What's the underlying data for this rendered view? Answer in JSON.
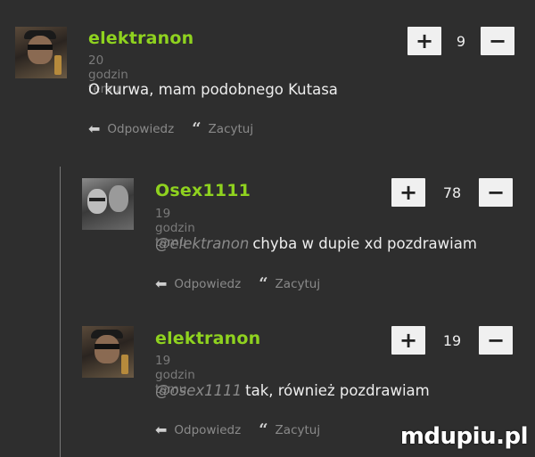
{
  "comments": [
    {
      "username": "elektranon",
      "timestamp": "20 godzin temu",
      "mention": "",
      "text": "O kurwa, mam podobnego Kutasa",
      "votes": "9",
      "reply_label": "Odpowiedz",
      "quote_label": "Zacytuj"
    },
    {
      "username": "Osex1111",
      "timestamp": "19 godzin temu",
      "mention": "@elektranon",
      "text": "chyba w dupie xd pozdrawiam",
      "votes": "78",
      "reply_label": "Odpowiedz",
      "quote_label": "Zacytuj"
    },
    {
      "username": "elektranon",
      "timestamp": "19 godzin temu",
      "mention": "@osex1111",
      "text": "tak, również pozdrawiam",
      "votes": "19",
      "reply_label": "Odpowiedz",
      "quote_label": "Zacytuj"
    }
  ],
  "vote_buttons": {
    "plus": "+",
    "minus": "−"
  },
  "icons": {
    "reply": "reply-arrow-icon",
    "quote": "quote-icon"
  },
  "watermark": "mdupiu.pl",
  "colors": {
    "background": "#2e2e2e",
    "username": "#8fd21f",
    "button": "#f0f0f0"
  }
}
